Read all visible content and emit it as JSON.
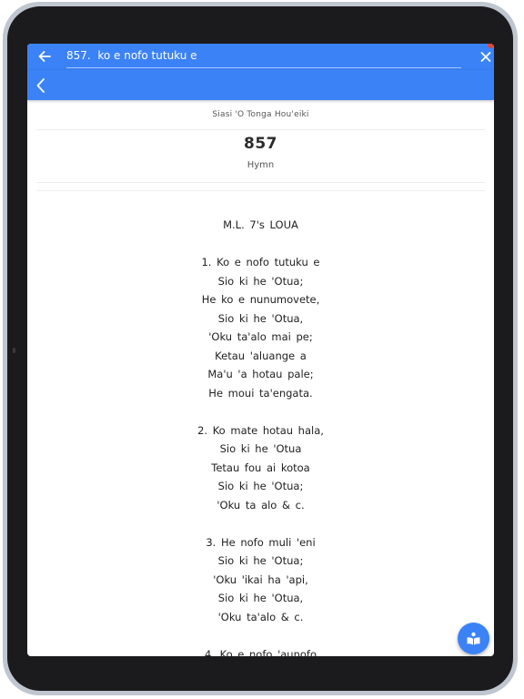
{
  "search": {
    "value": "857.  ko e nofo tutuku e"
  },
  "hymn": {
    "source": "Siasi 'O Tonga Hou'eiki",
    "number": "857",
    "type": "Hymn",
    "lyrics": "M.L.  7's  LOUA\n\n1.  Ko  e  nofo  tutuku  e\nSio  ki  he  'Otua;\nHe  ko  e  nunumovete,\nSio  ki  he  'Otua,\n'Oku  ta'alo  mai  pe;\nKetau  'aluange  a\nMa'u  'a  hotau  pale;\nHe  moui  ta'engata.\n\n2.   Ko  mate  hotau  hala,\nSio  ki  he  'Otua\nTetau  fou  ai  kotoa\nSio  ki  he  'Otua;\n'Oku  ta  alo  &  c.\n\n3.  He  nofo  muli  'eni\nSio  ki  he  'Otua;\n'Oku  'ikai  ha  'api,\nSio  ki  he  'Otua,\n'Oku  ta'alo  &  c.\n\n4.  Ko  e  nofo  'aunofo"
  },
  "colors": {
    "accent": "#3b82f6",
    "screen_background": "#ffffff",
    "bezel": "#1b1b1d"
  },
  "icons": {
    "search_back": "arrow-left-icon",
    "search_close": "close-icon",
    "app_back": "chevron-left-icon",
    "fab": "book-reader-icon"
  }
}
